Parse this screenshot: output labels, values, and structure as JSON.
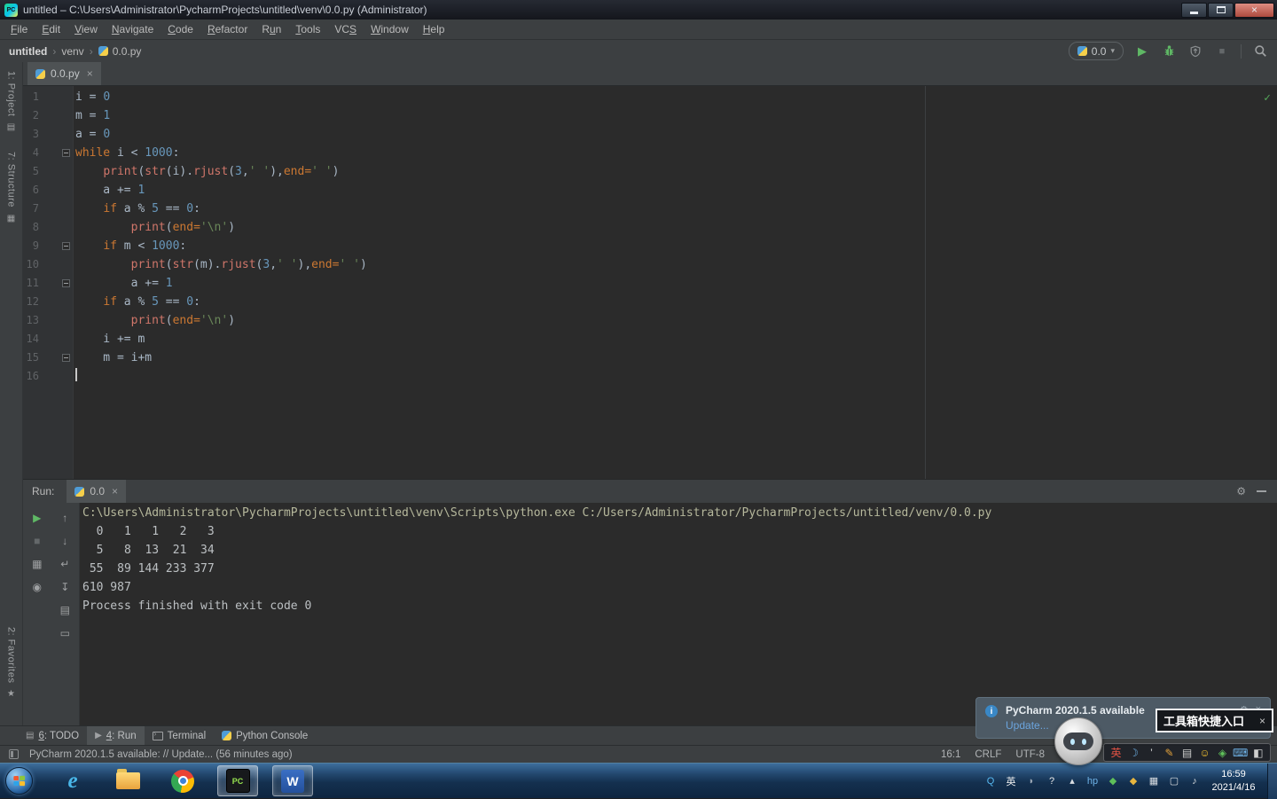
{
  "icons": {
    "close": "×",
    "gear": "⚙",
    "caret_down": "▾",
    "check": "✓",
    "run": "▶",
    "stop": "■"
  },
  "titlebar": {
    "app_badge": "PC",
    "title": "untitled – C:\\Users\\Administrator\\PycharmProjects\\untitled\\venv\\0.0.py (Administrator)"
  },
  "menubar": {
    "items": [
      {
        "label": "File",
        "u": 0
      },
      {
        "label": "Edit",
        "u": 0
      },
      {
        "label": "View",
        "u": 0
      },
      {
        "label": "Navigate",
        "u": 0
      },
      {
        "label": "Code",
        "u": 0
      },
      {
        "label": "Refactor",
        "u": 0
      },
      {
        "label": "Run",
        "u": 1
      },
      {
        "label": "Tools",
        "u": 0
      },
      {
        "label": "VCS",
        "u": 2
      },
      {
        "label": "Window",
        "u": 0
      },
      {
        "label": "Help",
        "u": 0
      }
    ]
  },
  "navbar": {
    "separator": "›",
    "breadcrumbs": [
      {
        "label": "untitled",
        "bold": true,
        "icon": null
      },
      {
        "label": "venv",
        "bold": false,
        "icon": null
      },
      {
        "label": "0.0.py",
        "bold": false,
        "icon": "python"
      }
    ],
    "run_config": "0.0"
  },
  "stripe": {
    "top": [
      {
        "label": "1: Project",
        "icon": "▤",
        "icon_name": "project-icon"
      },
      {
        "label": "7: Structure",
        "icon": "▦",
        "icon_name": "structure-icon"
      }
    ],
    "bottom": [
      {
        "label": "2: Favorites",
        "icon": "★",
        "icon_name": "favorites-icon"
      }
    ]
  },
  "editor": {
    "tab": {
      "label": "0.0.py"
    },
    "caret_line": 16,
    "fold_lines": [
      4,
      9,
      11,
      15
    ],
    "lines": [
      [
        [
          "d",
          "i = "
        ],
        [
          "n",
          "0"
        ]
      ],
      [
        [
          "d",
          "m = "
        ],
        [
          "n",
          "1"
        ]
      ],
      [
        [
          "d",
          "a = "
        ],
        [
          "n",
          "0"
        ]
      ],
      [
        [
          "k",
          "while"
        ],
        [
          "d",
          " i < "
        ],
        [
          "n",
          "1000"
        ],
        [
          "d",
          ":"
        ]
      ],
      [
        [
          "d",
          "    "
        ],
        [
          "f",
          "print"
        ],
        [
          "d",
          "("
        ],
        [
          "f",
          "str"
        ],
        [
          "d",
          "(i)."
        ],
        [
          "f",
          "rjust"
        ],
        [
          "d",
          "("
        ],
        [
          "n",
          "3"
        ],
        [
          "d",
          ","
        ],
        [
          "s",
          "' '"
        ],
        [
          "d",
          "),"
        ],
        [
          "p",
          "end="
        ],
        [
          "s",
          "' '"
        ],
        [
          "d",
          ")"
        ]
      ],
      [
        [
          "d",
          "    a += "
        ],
        [
          "n",
          "1"
        ]
      ],
      [
        [
          "d",
          "    "
        ],
        [
          "k",
          "if"
        ],
        [
          "d",
          " a % "
        ],
        [
          "n",
          "5"
        ],
        [
          "d",
          " == "
        ],
        [
          "n",
          "0"
        ],
        [
          "d",
          ":"
        ]
      ],
      [
        [
          "d",
          "        "
        ],
        [
          "f",
          "print"
        ],
        [
          "d",
          "("
        ],
        [
          "p",
          "end="
        ],
        [
          "s",
          "'\\n'"
        ],
        [
          "d",
          ")"
        ]
      ],
      [
        [
          "d",
          "    "
        ],
        [
          "k",
          "if"
        ],
        [
          "d",
          " m < "
        ],
        [
          "n",
          "1000"
        ],
        [
          "d",
          ":"
        ]
      ],
      [
        [
          "d",
          "        "
        ],
        [
          "f",
          "print"
        ],
        [
          "d",
          "("
        ],
        [
          "f",
          "str"
        ],
        [
          "d",
          "(m)."
        ],
        [
          "f",
          "rjust"
        ],
        [
          "d",
          "("
        ],
        [
          "n",
          "3"
        ],
        [
          "d",
          ","
        ],
        [
          "s",
          "' '"
        ],
        [
          "d",
          "),"
        ],
        [
          "p",
          "end="
        ],
        [
          "s",
          "' '"
        ],
        [
          "d",
          ")"
        ]
      ],
      [
        [
          "d",
          "        a += "
        ],
        [
          "n",
          "1"
        ]
      ],
      [
        [
          "d",
          "    "
        ],
        [
          "k",
          "if"
        ],
        [
          "d",
          " a % "
        ],
        [
          "n",
          "5"
        ],
        [
          "d",
          " == "
        ],
        [
          "n",
          "0"
        ],
        [
          "d",
          ":"
        ]
      ],
      [
        [
          "d",
          "        "
        ],
        [
          "f",
          "print"
        ],
        [
          "d",
          "("
        ],
        [
          "p",
          "end="
        ],
        [
          "s",
          "'\\n'"
        ],
        [
          "d",
          ")"
        ]
      ],
      [
        [
          "d",
          "    i += m"
        ]
      ],
      [
        [
          "d",
          "    m = i+m"
        ]
      ],
      []
    ]
  },
  "run_panel": {
    "title": "Run:",
    "tab": "0.0",
    "toolbar": {
      "col1": [
        {
          "name": "rerun-icon",
          "glyph": "▶",
          "color": "#5fb865"
        },
        {
          "name": "stop-icon",
          "glyph": "■",
          "color": "#64686a"
        },
        {
          "name": "restore-layout-icon",
          "glyph": "▦",
          "color": "#9fa1a3"
        },
        {
          "name": "pin-icon",
          "glyph": "◉",
          "color": "#9fa1a3"
        }
      ],
      "col2": [
        {
          "name": "up-stack-trace-icon",
          "glyph": "↑",
          "color": "#9fa1a3"
        },
        {
          "name": "down-stack-trace-icon",
          "glyph": "↓",
          "color": "#9fa1a3"
        },
        {
          "name": "soft-wrap-icon",
          "glyph": "↵",
          "color": "#9fa1a3"
        },
        {
          "name": "scroll-to-end-icon",
          "glyph": "↧",
          "color": "#9fa1a3"
        },
        {
          "name": "print-icon",
          "glyph": "▤",
          "color": "#9fa1a3"
        },
        {
          "name": "clear-all-icon",
          "glyph": "▭",
          "color": "#9fa1a3"
        }
      ]
    },
    "console": [
      {
        "c": "cmd",
        "t": "C:\\Users\\Administrator\\PycharmProjects\\untitled\\venv\\Scripts\\python.exe C:/Users/Administrator/PycharmProjects/untitled/venv/0.0.py"
      },
      {
        "c": "out",
        "t": "  0   1   1   2   3"
      },
      {
        "c": "out",
        "t": "  5   8  13  21  34"
      },
      {
        "c": "out",
        "t": " 55  89 144 233 377"
      },
      {
        "c": "out",
        "t": "610 987"
      },
      {
        "c": "sys",
        "t": "Process finished with exit code 0"
      }
    ]
  },
  "bottom_bar": {
    "items": [
      {
        "label": "6: TODO",
        "u": 0,
        "icon": "todo",
        "active": false
      },
      {
        "label": "4: Run",
        "u": 0,
        "icon": "run",
        "active": true
      },
      {
        "label": "Terminal",
        "u": -1,
        "icon": "terminal",
        "active": false
      },
      {
        "label": "Python Console",
        "u": -1,
        "icon": "python",
        "active": false
      }
    ]
  },
  "status_bar": {
    "message": "PyCharm 2020.1.5 available: // Update... (56 minutes ago)",
    "caret_pos": "16:1",
    "line_sep": "CRLF",
    "encoding": "UTF-8"
  },
  "notification": {
    "icon": "i",
    "title": "PyCharm 2020.1.5 available",
    "action": "Update..."
  },
  "toolbox_popup": {
    "text": "工具箱快捷入口"
  },
  "taskbar": {
    "apps": [
      {
        "name": "ie",
        "type": "ie",
        "label": "e",
        "active": false,
        "focused": false
      },
      {
        "name": "explorer",
        "type": "folder",
        "label": "",
        "active": false,
        "focused": false
      },
      {
        "name": "chrome",
        "type": "chrome",
        "label": "",
        "active": false,
        "focused": false
      },
      {
        "name": "pycharm",
        "type": "pycharm",
        "label": "PC",
        "active": true,
        "focused": true
      },
      {
        "name": "word",
        "type": "word",
        "label": "W",
        "active": true,
        "focused": false
      }
    ],
    "tray": [
      {
        "name": "qq-tray-icon",
        "glyph": "Q",
        "color": "#57b8f0"
      },
      {
        "name": "ime-lang-tray-icon",
        "glyph": "英",
        "color": "#f0f0f0"
      },
      {
        "name": "tray-misc-icon",
        "glyph": "◗",
        "color": "#9aa7b5"
      },
      {
        "name": "help-tray-icon",
        "glyph": "?",
        "color": "#e8e8e8"
      },
      {
        "name": "hidden-icons-icon",
        "glyph": "▴",
        "color": "#dadee2"
      },
      {
        "name": "hp-tray-icon",
        "glyph": "hp",
        "color": "#6fb3e8"
      },
      {
        "name": "security-tray-icon",
        "glyph": "◆",
        "color": "#5fc05a"
      },
      {
        "name": "tray-yellow-icon",
        "glyph": "◆",
        "color": "#e8b63f"
      },
      {
        "name": "message-tray-icon",
        "glyph": "▦",
        "color": "#dadee2"
      },
      {
        "name": "display-tray-icon",
        "glyph": "▢",
        "color": "#dadee2"
      },
      {
        "name": "volume-tray-icon",
        "glyph": "♪",
        "color": "#dadee2"
      }
    ],
    "ime_bar": [
      {
        "name": "ime-lang-icon",
        "glyph": "英",
        "color": "#e05244"
      },
      {
        "name": "ime-halfmoon-icon",
        "glyph": "☽",
        "color": "#6fb3e8"
      },
      {
        "name": "ime-punct-icon",
        "glyph": "’",
        "color": "#e0e0e0"
      },
      {
        "name": "ime-pen-icon",
        "glyph": "✎",
        "color": "#e2a23c"
      },
      {
        "name": "ime-clipboard-icon",
        "glyph": "▤",
        "color": "#cfcfcf"
      },
      {
        "name": "ime-emoji-icon",
        "glyph": "☺",
        "color": "#f2c230"
      },
      {
        "name": "ime-shield-icon",
        "glyph": "◈",
        "color": "#5fc05a"
      },
      {
        "name": "ime-keyboard-icon",
        "glyph": "⌨",
        "color": "#6fb3e8"
      },
      {
        "name": "ime-toolbox-icon",
        "glyph": "◧",
        "color": "#cfcfcf"
      }
    ],
    "clock": {
      "time": "16:59",
      "date": "2021/4/16"
    }
  }
}
